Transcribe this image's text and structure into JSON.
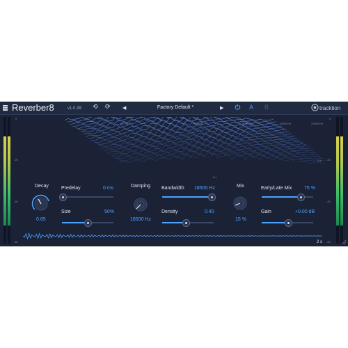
{
  "header": {
    "title": "Reverber8",
    "version": "v1.0.39",
    "preset": "Factory Default *",
    "ab_label": "A",
    "b_label": "B",
    "brand": "tracktion"
  },
  "meters": {
    "left_level": 0.7,
    "right_level": 0.7,
    "ticks": [
      "0",
      "-20",
      "-40",
      "-60"
    ]
  },
  "spectrum": {
    "freq_labels": [
      "500 Hz",
      "2000 Hz",
      "5000 Hz",
      "10000 Hz",
      "20000 Hz"
    ],
    "time_start": "0 s",
    "time_end": "5 s"
  },
  "controls": {
    "decay": {
      "label": "Decay",
      "value": "0.65"
    },
    "predelay": {
      "label": "Predelay",
      "value": "0 ms",
      "fraction": 0.0
    },
    "size": {
      "label": "Size",
      "value": "50%",
      "fraction": 0.5
    },
    "damping": {
      "label": "Damping",
      "value": "18500 Hz"
    },
    "bandwidth": {
      "label": "Bandwidth",
      "value": "18500 Hz",
      "fraction": 0.95
    },
    "density": {
      "label": "Density",
      "value": "0.40",
      "fraction": 0.4
    },
    "mix": {
      "label": "Mix",
      "value": "15 %"
    },
    "early_late": {
      "label": "Early/Late Mix",
      "value": "75 %",
      "fraction": 0.75
    },
    "gain": {
      "label": "Gain",
      "value": "+0.00 dB",
      "fraction": 0.5
    }
  },
  "waveform": {
    "time_label": "2 s"
  },
  "colors": {
    "accent": "#4aa3ff",
    "bg": "#1b2236",
    "header": "#202a40"
  }
}
